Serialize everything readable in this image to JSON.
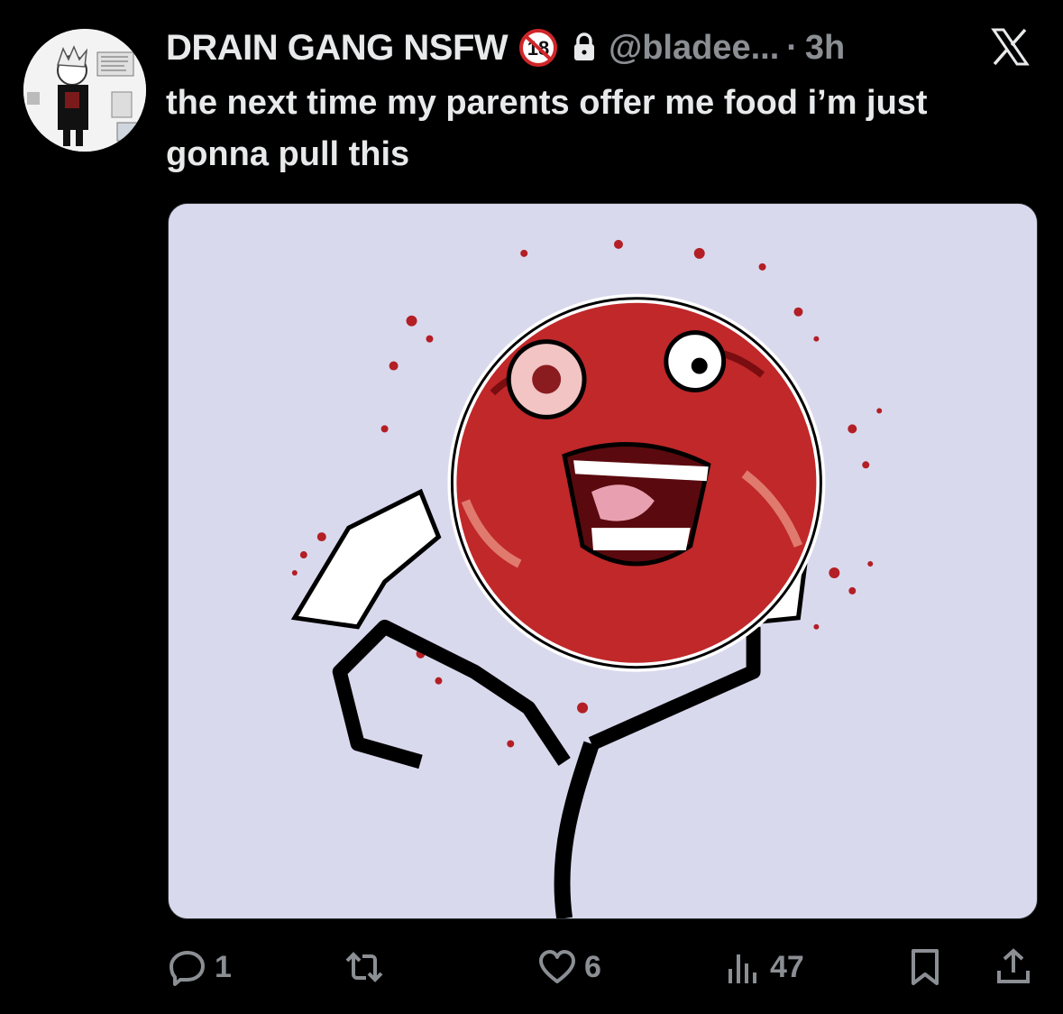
{
  "tweet": {
    "display_name": "DRAIN GANG NSFW",
    "badge_18": "18",
    "handle": "@bladee...",
    "separator": "·",
    "time": "3h",
    "text": "the next time my parents  offer me food i’m just gonna pull this"
  },
  "media": {
    "icon": "rage-face-meme-image"
  },
  "actions": {
    "reply_count": "1",
    "retweet_count": "",
    "like_count": "6",
    "views_count": "47"
  },
  "colors": {
    "background": "#000000",
    "text": "#e7e9ea",
    "muted": "#8b8f94",
    "media_bg": "#d9d9ee",
    "face_red": "#c0282a"
  }
}
